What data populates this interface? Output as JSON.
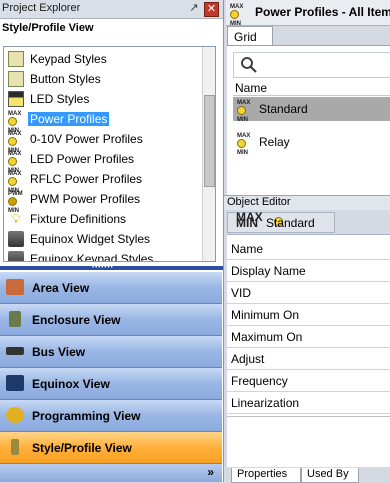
{
  "project_explorer": {
    "title": "Project Explorer",
    "pin_glyph": "↗",
    "close_glyph": "✕",
    "section_title": "Style/Profile View",
    "tree_items": [
      {
        "label": "Keypad Styles",
        "icon": "keypad-styles-icon"
      },
      {
        "label": "Button Styles",
        "icon": "button-styles-icon"
      },
      {
        "label": "LED Styles",
        "icon": "led-styles-icon"
      },
      {
        "label": "Power Profiles",
        "icon": "power-profile-icon",
        "selected": true
      },
      {
        "label": "0-10V Power Profiles",
        "icon": "power-profile-icon"
      },
      {
        "label": "LED Power Profiles",
        "icon": "power-profile-icon"
      },
      {
        "label": "RFLC Power Profiles",
        "icon": "power-profile-icon"
      },
      {
        "label": "PWM Power Profiles",
        "icon": "pwm-profile-icon"
      },
      {
        "label": "Fixture Definitions",
        "icon": "fixture-icon"
      },
      {
        "label": "Equinox Widget Styles",
        "icon": "equinox-widget-icon"
      },
      {
        "label": "Equinox Keypad Styles",
        "icon": "equinox-keypad-icon"
      }
    ],
    "splitter_dots": "•••••••",
    "nav_buttons": [
      {
        "label": "Area View",
        "icon": "area-view-icon",
        "color": "#c86a3a"
      },
      {
        "label": "Enclosure View",
        "icon": "enclosure-view-icon",
        "color": "#6a7a4a"
      },
      {
        "label": "Bus View",
        "icon": "bus-view-icon",
        "color": "#333333"
      },
      {
        "label": "Equinox View",
        "icon": "equinox-view-icon",
        "color": "#1f3a6a"
      },
      {
        "label": "Programming View",
        "icon": "programming-view-icon",
        "color": "#e0b020"
      },
      {
        "label": "Style/Profile View",
        "icon": "style-profile-view-icon",
        "color": "#9a8a40",
        "active": true
      }
    ],
    "footer_chevron": "»"
  },
  "power_profiles": {
    "title": "Power Profiles - All Item",
    "grid_tab": "Grid",
    "column_header": "Name",
    "rows": [
      {
        "label": "Standard",
        "selected": true
      },
      {
        "label": "Relay"
      }
    ]
  },
  "object_editor": {
    "title": "Object Editor",
    "tab_label": "Standard",
    "properties": [
      "Name",
      "Display Name",
      "VID",
      "Minimum On",
      "Maximum On",
      "Adjust",
      "Frequency",
      "Linearization"
    ],
    "bottom_tabs": [
      "Properties",
      "Used By"
    ]
  },
  "colors": {
    "selection": "#3399ff",
    "nav_blue": "#9ab6e4",
    "nav_active": "#ffb03a",
    "grid_selected": "#a9a9a9"
  }
}
